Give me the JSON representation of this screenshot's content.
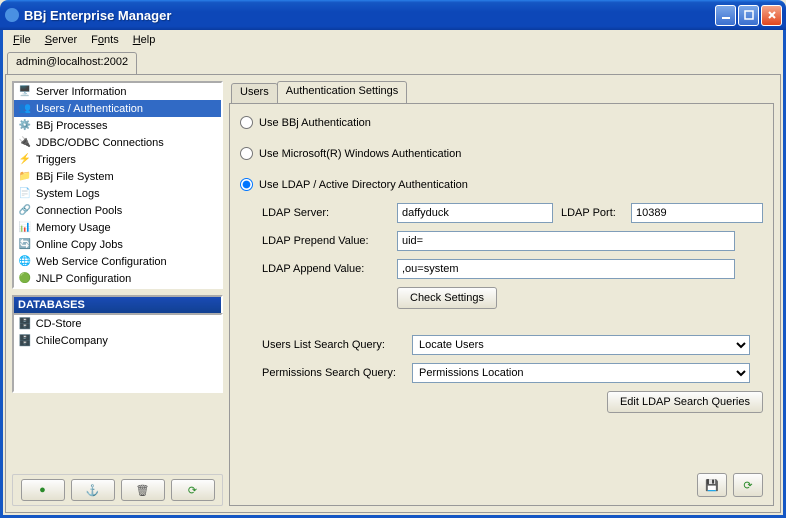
{
  "window": {
    "title": "BBj Enterprise Manager"
  },
  "menubar": {
    "file": "File",
    "server": "Server",
    "fonts": "Fonts",
    "help": "Help"
  },
  "connection_tab": "admin@localhost:2002",
  "nav": {
    "items": [
      {
        "label": "Server Information"
      },
      {
        "label": "Users / Authentication"
      },
      {
        "label": "BBj Processes"
      },
      {
        "label": "JDBC/ODBC Connections"
      },
      {
        "label": "Triggers"
      },
      {
        "label": "BBj File System"
      },
      {
        "label": "System Logs"
      },
      {
        "label": "Connection Pools"
      },
      {
        "label": "Memory Usage"
      },
      {
        "label": "Online Copy Jobs"
      },
      {
        "label": "Web Service Configuration"
      },
      {
        "label": "JNLP Configuration"
      }
    ]
  },
  "databases": {
    "header": "DATABASES",
    "items": [
      {
        "label": "CD-Store"
      },
      {
        "label": "ChileCompany"
      }
    ]
  },
  "tabs": {
    "users": "Users",
    "auth": "Authentication Settings"
  },
  "auth": {
    "opt_bbj": "Use BBj Authentication",
    "opt_win": "Use Microsoft(R) Windows Authentication",
    "opt_ldap": "Use LDAP / Active Directory Authentication",
    "ldap_server_lbl": "LDAP Server:",
    "ldap_server_val": "daffyduck",
    "ldap_port_lbl": "LDAP Port:",
    "ldap_port_val": "10389",
    "prepend_lbl": "LDAP Prepend Value:",
    "prepend_val": "uid=",
    "append_lbl": "LDAP Append Value:",
    "append_val": ",ou=system",
    "check_btn": "Check Settings",
    "users_query_lbl": "Users List Search Query:",
    "users_query_val": "Locate Users",
    "perms_query_lbl": "Permissions Search Query:",
    "perms_query_val": "Permissions Location",
    "edit_queries_btn": "Edit LDAP Search Queries"
  }
}
